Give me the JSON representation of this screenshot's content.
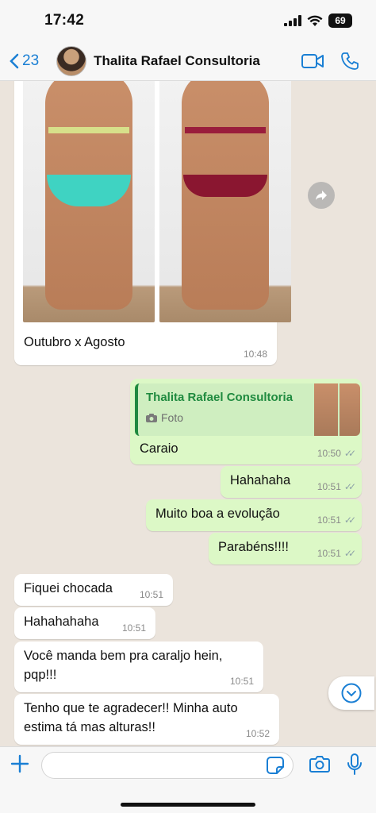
{
  "status": {
    "time": "17:42",
    "battery": "69"
  },
  "header": {
    "back_count": "23",
    "contact_name": "Thalita Rafael Consultoria"
  },
  "messages": [
    {
      "text": "Outubro x Agosto",
      "time": "10:48"
    },
    {
      "quote_name": "Thalita Rafael Consultoria",
      "quote_sub": "Foto",
      "text": "Caraio",
      "time": "10:50"
    },
    {
      "text": "Hahahaha",
      "time": "10:51"
    },
    {
      "text": "Muito boa a evolução",
      "time": "10:51"
    },
    {
      "text": "Parabéns!!!!",
      "time": "10:51"
    },
    {
      "text": "Fiquei chocada",
      "time": "10:51"
    },
    {
      "text": "Hahahahaha",
      "time": "10:51"
    },
    {
      "line1": "Você manda bem pra caraljo hein,",
      "line2": "pqp!!!",
      "time": "10:51"
    },
    {
      "line1": "Tenho que te agradecer!! Minha auto",
      "line2": "estima tá mas alturas!!",
      "time": "10:52"
    }
  ],
  "colors": {
    "accent": "#1a7fd4",
    "outgoing": "#dcf8c6",
    "incoming": "#ffffff"
  }
}
